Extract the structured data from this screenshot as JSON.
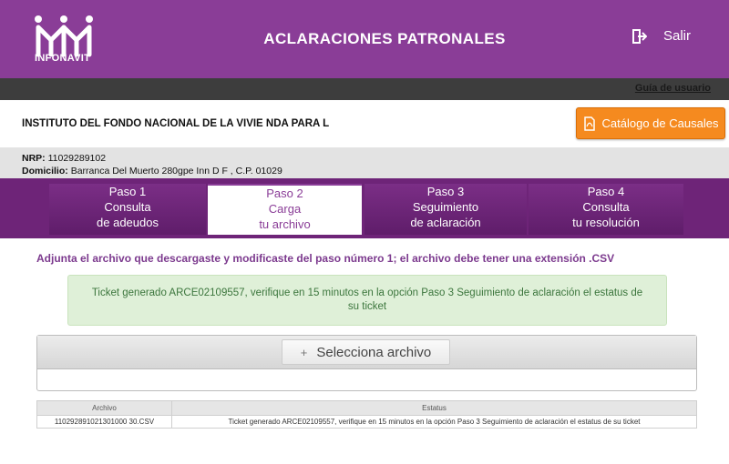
{
  "header": {
    "logo_text": "INFONAVIT",
    "title": "ACLARACIONES PATRONALES",
    "logout_label": "Salir"
  },
  "subbar": {
    "guide_link": "Guía de usuario"
  },
  "company": {
    "name": "INSTITUTO DEL FONDO NACIONAL DE LA VIVIE NDA PARA L",
    "catalog_button": "Catálogo de Causales",
    "nrp_label": "NRP:",
    "nrp_value": "11029289102",
    "address_label": "Domicilio:",
    "address_value": "Barranca Del Muerto 280gpe Inn D F , C.P. 01029"
  },
  "steps": [
    {
      "num": "Paso 1",
      "line1": "Consulta",
      "line2": "de adeudos"
    },
    {
      "num": "Paso 2",
      "line1": "Carga",
      "line2": "tu archivo"
    },
    {
      "num": "Paso 3",
      "line1": "Seguimiento",
      "line2": "de aclaración"
    },
    {
      "num": "Paso 4",
      "line1": "Consulta",
      "line2": "tu resolución"
    }
  ],
  "active_step": 2,
  "main": {
    "instruction": "Adjunta el archivo que descargaste y modificaste del paso número 1; el archivo debe tener una extensión .CSV",
    "alert": "Ticket generado ARCE02109557, verifique en 15 minutos en la opción Paso 3 Seguimiento de aclaración el estatus de su ticket",
    "select_button": "Selecciona archivo"
  },
  "table": {
    "headers": [
      "Archivo",
      "Estatus"
    ],
    "rows": [
      [
        "110292891021301000 30.CSV",
        "Ticket generado ARCE02109557, verifique en 15 minutos en la opción Paso 3 Seguimiento de aclaración el estatus de su ticket"
      ]
    ]
  },
  "colors": {
    "brand_purple": "#8a3d97",
    "steps_purple": "#6e2478",
    "accent_orange": "#f58a1f",
    "success_bg": "#dff0d8",
    "success_text": "#3c763d"
  }
}
